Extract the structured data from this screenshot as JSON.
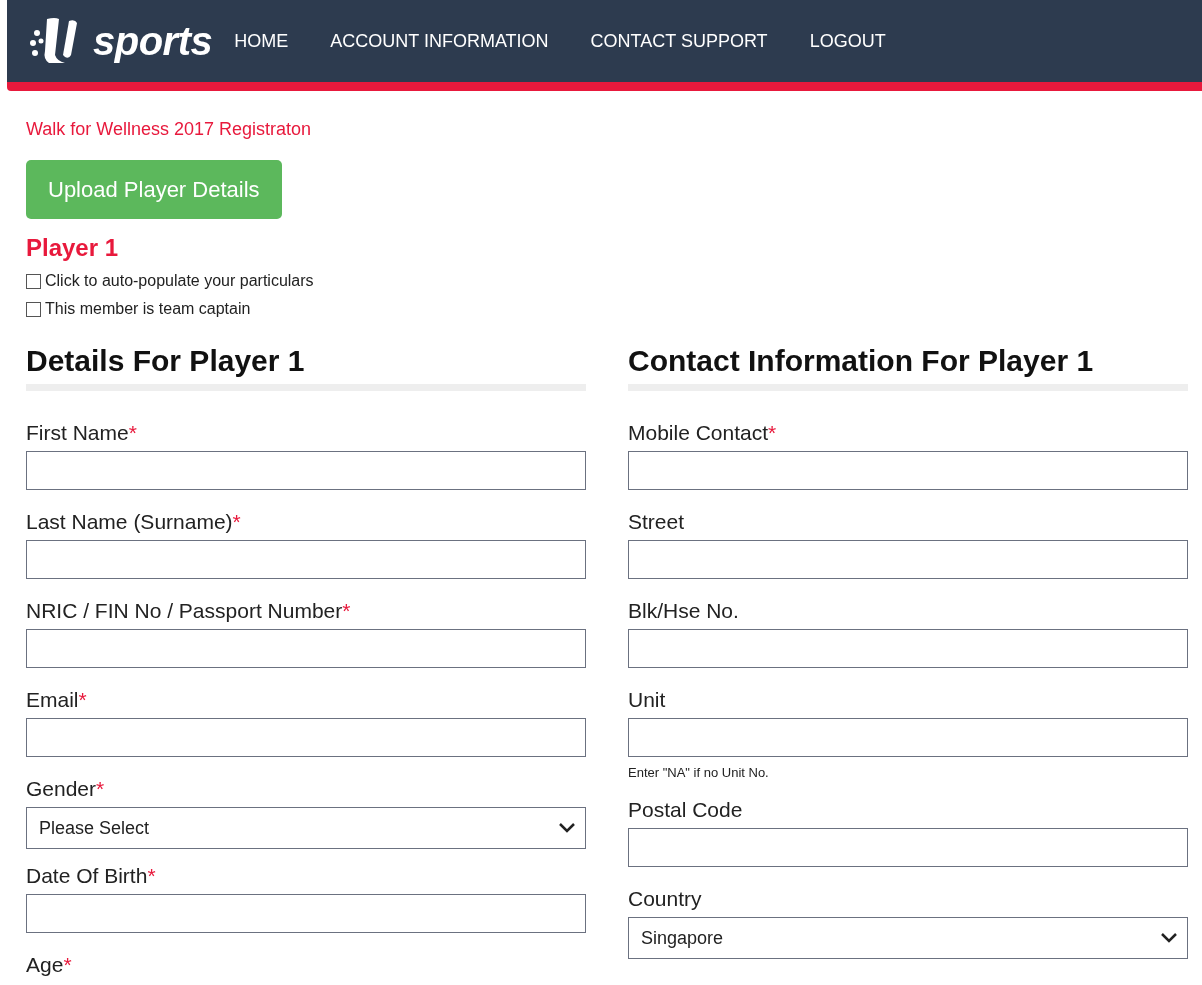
{
  "nav": {
    "logo_text": "sports",
    "links": [
      {
        "label": "HOME"
      },
      {
        "label": "ACCOUNT INFORMATION"
      },
      {
        "label": "CONTACT SUPPORT"
      },
      {
        "label": "LOGOUT"
      }
    ]
  },
  "event_title": "Walk for Wellness 2017 Registraton",
  "upload_button": "Upload Player Details",
  "player_heading": "Player 1",
  "options": [
    {
      "label": "Click to auto-populate your particulars",
      "checked": false
    },
    {
      "label": "This member is team captain",
      "checked": false
    }
  ],
  "columns": [
    {
      "heading": "Details For Player 1",
      "fields": [
        {
          "kind": "text",
          "label": "First Name",
          "required_mark": "*"
        },
        {
          "kind": "text",
          "label": "Last Name (Surname)",
          "required_mark": "*"
        },
        {
          "kind": "text",
          "label": "NRIC / FIN No / Passport Number",
          "required_mark": "*"
        },
        {
          "kind": "text",
          "label": "Email",
          "required_mark": "*"
        },
        {
          "kind": "select",
          "label": "Gender",
          "required_mark": "*",
          "value": "Please Select"
        },
        {
          "kind": "text",
          "label": "Date Of Birth",
          "required_mark": "*"
        },
        {
          "kind": "label",
          "label": "Age",
          "required_mark": "*"
        }
      ]
    },
    {
      "heading": "Contact Information For Player 1",
      "fields": [
        {
          "kind": "text",
          "label": "Mobile Contact",
          "required_mark": "*"
        },
        {
          "kind": "text",
          "label": "Street"
        },
        {
          "kind": "text",
          "label": "Blk/Hse No."
        },
        {
          "kind": "text",
          "label": "Unit",
          "hint": "Enter \"NA\" if no Unit No."
        },
        {
          "kind": "text",
          "label": "Postal Code"
        },
        {
          "kind": "select",
          "label": "Country",
          "value": "Singapore"
        }
      ]
    }
  ]
}
